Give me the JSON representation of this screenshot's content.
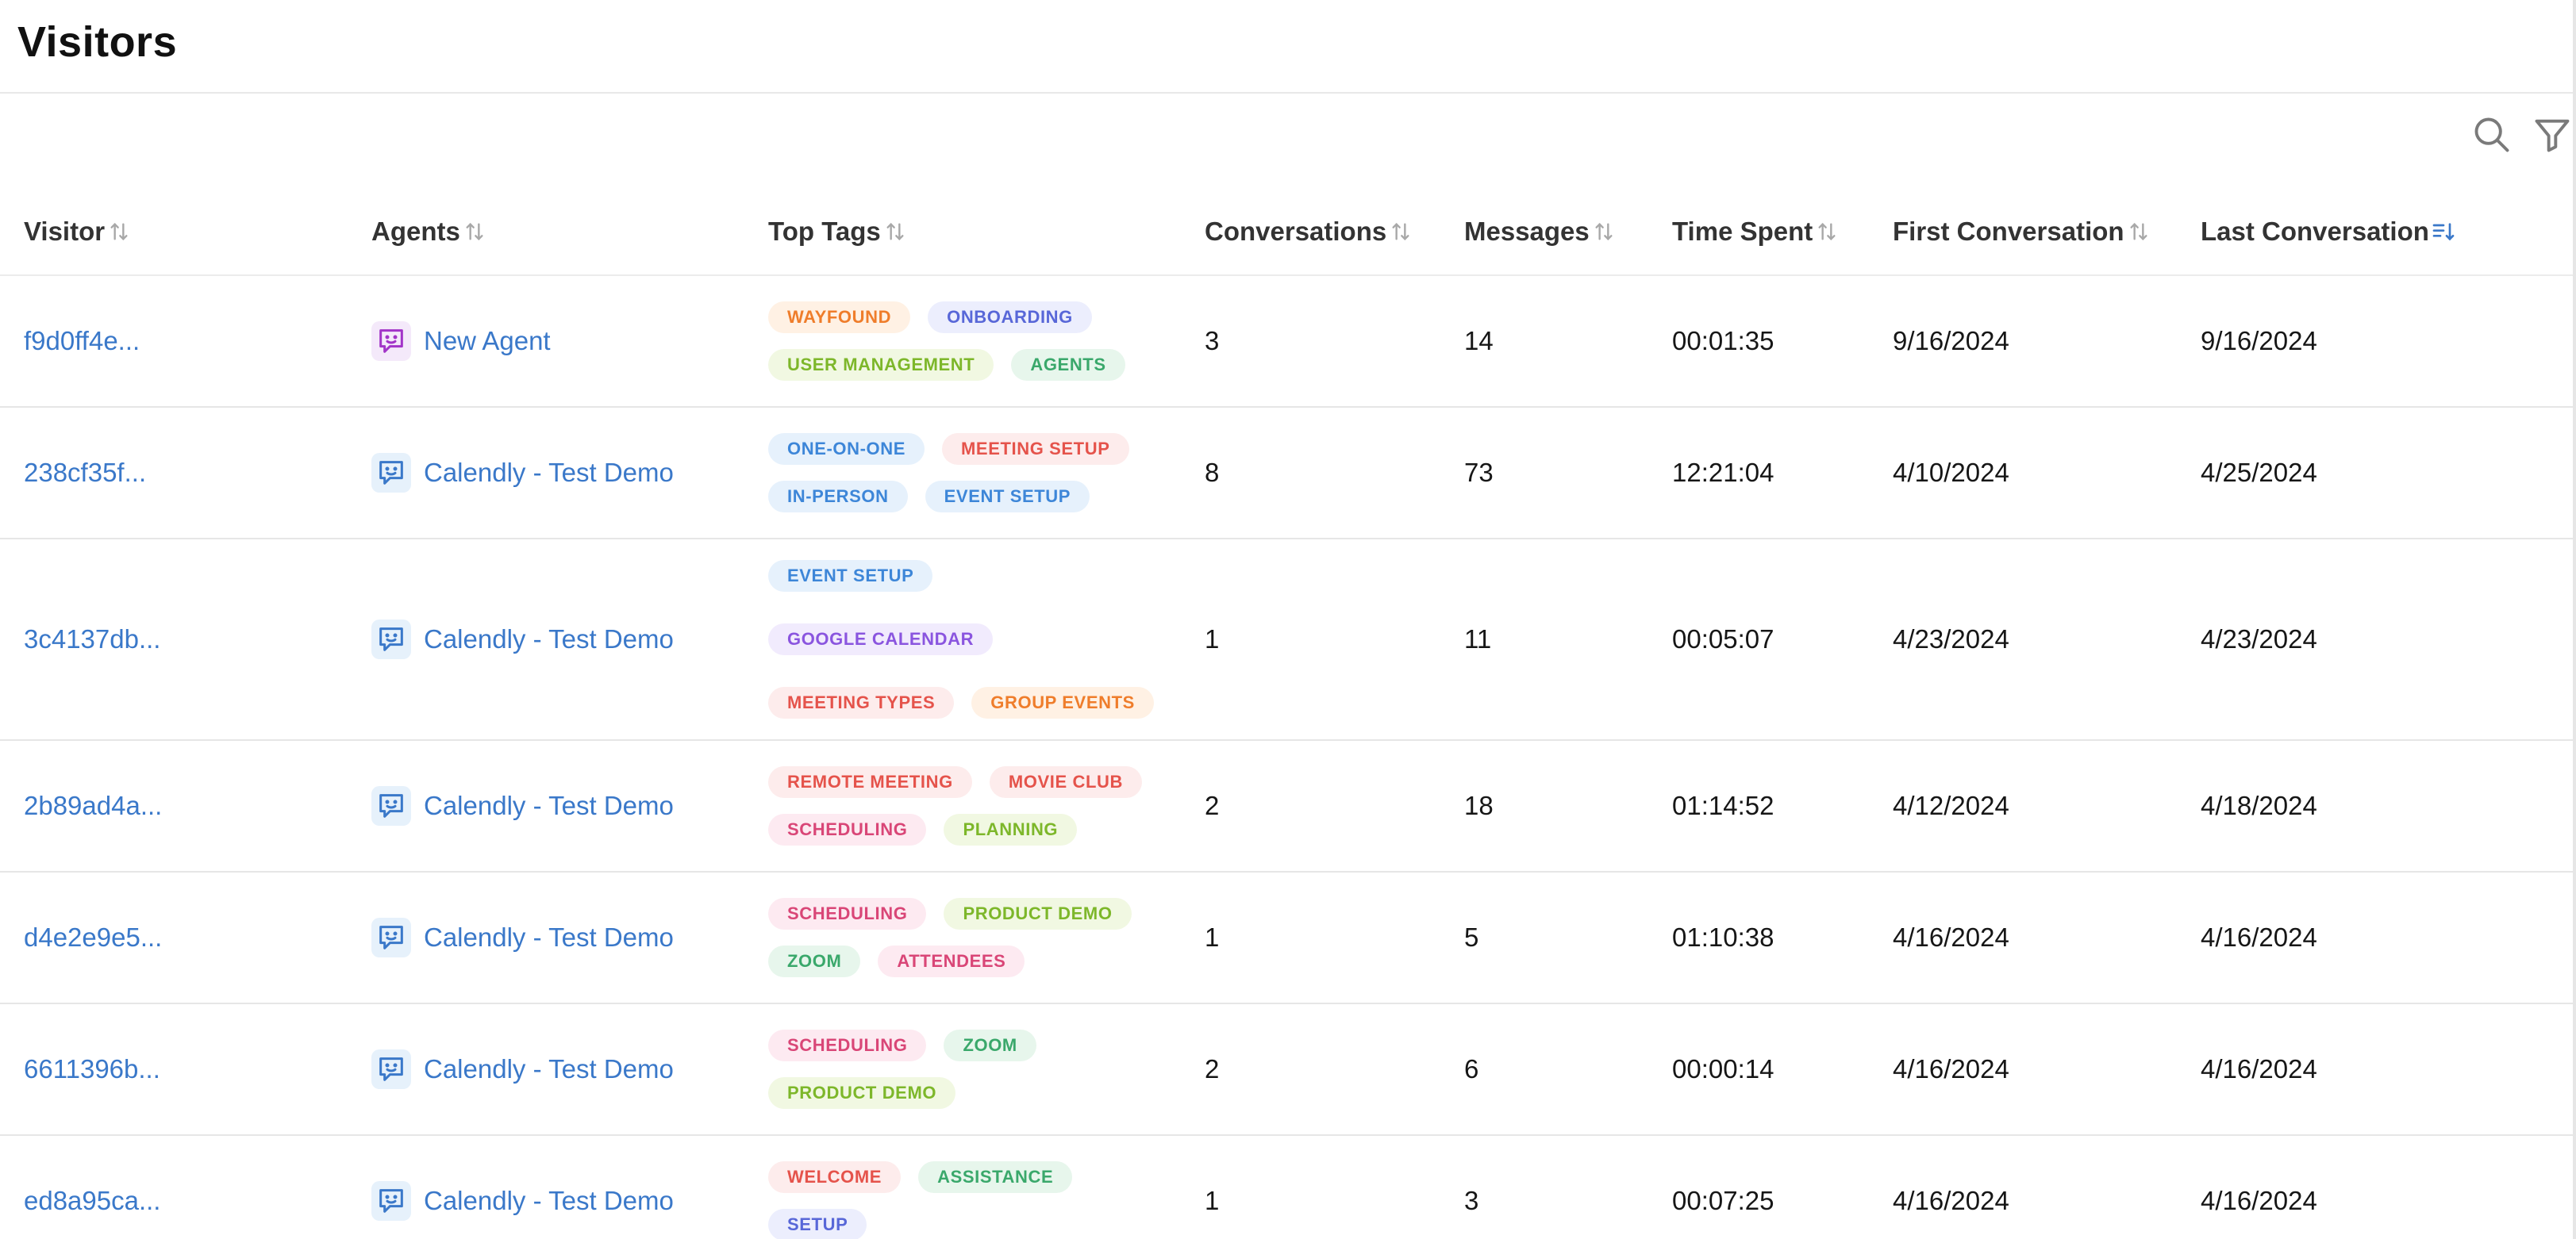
{
  "page": {
    "title": "Visitors"
  },
  "toolbar": {
    "search_icon": "search-icon",
    "filter_icon": "filter-icon"
  },
  "columns": [
    {
      "key": "visitor",
      "label": "Visitor",
      "sort": "none"
    },
    {
      "key": "agents",
      "label": "Agents",
      "sort": "none"
    },
    {
      "key": "top_tags",
      "label": "Top Tags",
      "sort": "none"
    },
    {
      "key": "conversations",
      "label": "Conversations",
      "sort": "none"
    },
    {
      "key": "messages",
      "label": "Messages",
      "sort": "none"
    },
    {
      "key": "time_spent",
      "label": "Time Spent",
      "sort": "none"
    },
    {
      "key": "first_conversation",
      "label": "First Conversation",
      "sort": "none"
    },
    {
      "key": "last_conversation",
      "label": "Last Conversation",
      "sort": "descending"
    }
  ],
  "colors": {
    "link": "#3a78c9",
    "sort_active": "#3a78c9",
    "sort_inactive": "#a8a8a8",
    "agent_purple_bg": "#f4e9fa",
    "agent_purple_fg": "#a234c8",
    "agent_blue_bg": "#e6f1fb",
    "agent_blue_fg": "#3a78c9"
  },
  "tag_palette": {
    "orange": {
      "bg": "#fff1e4",
      "fg": "#ef7d2b"
    },
    "indigo": {
      "bg": "#eceefd",
      "fg": "#5867d8"
    },
    "lime": {
      "bg": "#f1f8e2",
      "fg": "#7db72a"
    },
    "green": {
      "bg": "#e7f6ec",
      "fg": "#3aa86b"
    },
    "blue": {
      "bg": "#e6f1fc",
      "fg": "#3d86d8"
    },
    "red": {
      "bg": "#fdecec",
      "fg": "#e5534b"
    },
    "purple": {
      "bg": "#f1ebfd",
      "fg": "#8a55df"
    },
    "pink": {
      "bg": "#fdeaf1",
      "fg": "#d94677"
    }
  },
  "rows": [
    {
      "visitor": "f9d0ff4e...",
      "agent": {
        "name": "New Agent",
        "icon": "chat-smile-icon",
        "color": "purple"
      },
      "tags": [
        {
          "label": "WAYFOUND",
          "color": "orange"
        },
        {
          "label": "ONBOARDING",
          "color": "indigo"
        },
        {
          "label": "USER MANAGEMENT",
          "color": "lime"
        },
        {
          "label": "AGENTS",
          "color": "green"
        }
      ],
      "conversations": "3",
      "messages": "14",
      "time_spent": "00:01:35",
      "first_conversation": "9/16/2024",
      "last_conversation": "9/16/2024"
    },
    {
      "visitor": "238cf35f...",
      "agent": {
        "name": "Calendly - Test Demo",
        "icon": "chat-smile-icon",
        "color": "blue"
      },
      "tags": [
        {
          "label": "ONE-ON-ONE",
          "color": "blue"
        },
        {
          "label": "MEETING SETUP",
          "color": "red"
        },
        {
          "label": "IN-PERSON",
          "color": "blue"
        },
        {
          "label": "EVENT SETUP",
          "color": "blue"
        }
      ],
      "conversations": "8",
      "messages": "73",
      "time_spent": "12:21:04",
      "first_conversation": "4/10/2024",
      "last_conversation": "4/25/2024"
    },
    {
      "visitor": "3c4137db...",
      "agent": {
        "name": "Calendly - Test Demo",
        "icon": "chat-smile-icon",
        "color": "blue"
      },
      "tags": [
        {
          "label": "EVENT SETUP",
          "color": "blue"
        },
        {
          "label": "GOOGLE CALENDAR",
          "color": "purple"
        },
        {
          "label": "MEETING TYPES",
          "color": "red"
        },
        {
          "label": "GROUP EVENTS",
          "color": "orange"
        }
      ],
      "conversations": "1",
      "messages": "11",
      "time_spent": "00:05:07",
      "first_conversation": "4/23/2024",
      "last_conversation": "4/23/2024"
    },
    {
      "visitor": "2b89ad4a...",
      "agent": {
        "name": "Calendly - Test Demo",
        "icon": "chat-smile-icon",
        "color": "blue"
      },
      "tags": [
        {
          "label": "REMOTE MEETING",
          "color": "red"
        },
        {
          "label": "MOVIE CLUB",
          "color": "red"
        },
        {
          "label": "SCHEDULING",
          "color": "pink"
        },
        {
          "label": "PLANNING",
          "color": "lime"
        }
      ],
      "conversations": "2",
      "messages": "18",
      "time_spent": "01:14:52",
      "first_conversation": "4/12/2024",
      "last_conversation": "4/18/2024"
    },
    {
      "visitor": "d4e2e9e5...",
      "agent": {
        "name": "Calendly - Test Demo",
        "icon": "chat-smile-icon",
        "color": "blue"
      },
      "tags": [
        {
          "label": "SCHEDULING",
          "color": "pink"
        },
        {
          "label": "PRODUCT DEMO",
          "color": "lime"
        },
        {
          "label": "ZOOM",
          "color": "green"
        },
        {
          "label": "ATTENDEES",
          "color": "pink"
        }
      ],
      "conversations": "1",
      "messages": "5",
      "time_spent": "01:10:38",
      "first_conversation": "4/16/2024",
      "last_conversation": "4/16/2024"
    },
    {
      "visitor": "6611396b...",
      "agent": {
        "name": "Calendly - Test Demo",
        "icon": "chat-smile-icon",
        "color": "blue"
      },
      "tags": [
        {
          "label": "SCHEDULING",
          "color": "pink"
        },
        {
          "label": "ZOOM",
          "color": "green"
        },
        {
          "label": "PRODUCT DEMO",
          "color": "lime"
        }
      ],
      "conversations": "2",
      "messages": "6",
      "time_spent": "00:00:14",
      "first_conversation": "4/16/2024",
      "last_conversation": "4/16/2024"
    },
    {
      "visitor": "ed8a95ca...",
      "agent": {
        "name": "Calendly - Test Demo",
        "icon": "chat-smile-icon",
        "color": "blue"
      },
      "tags": [
        {
          "label": "WELCOME",
          "color": "red"
        },
        {
          "label": "ASSISTANCE",
          "color": "green"
        },
        {
          "label": "SETUP",
          "color": "indigo"
        }
      ],
      "conversations": "1",
      "messages": "3",
      "time_spent": "00:07:25",
      "first_conversation": "4/16/2024",
      "last_conversation": "4/16/2024"
    }
  ]
}
